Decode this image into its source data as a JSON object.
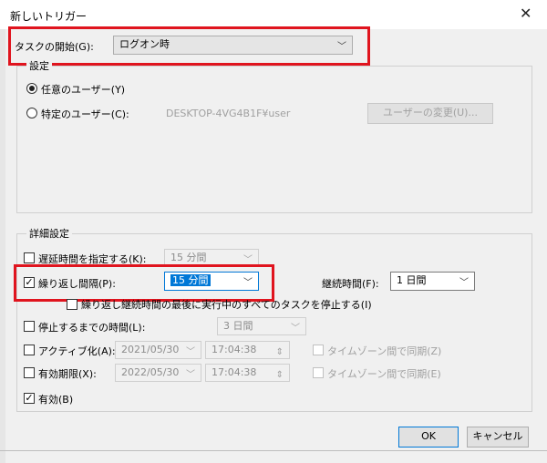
{
  "dialog": {
    "title": "新しいトリガー",
    "close_glyph": "✕"
  },
  "task_start": {
    "label": "タスクの開始(G):",
    "value": "ログオン時"
  },
  "settings": {
    "legend": "設定",
    "any_user": "任意のユーザー(Y)",
    "specific_user": "特定のユーザー(C):",
    "user_name": "DESKTOP-4VG4B1F¥user",
    "change_user_button": "ユーザーの変更(U)..."
  },
  "advanced": {
    "legend": "詳細設定",
    "delay_label": "遅延時間を指定する(K):",
    "delay_value": "15 分間",
    "repeat_label": "繰り返し間隔(P):",
    "repeat_value": "15 分間",
    "duration_label": "継続時間(F):",
    "duration_value": "1 日間",
    "stop_all_label": "繰り返し継続時間の最後に実行中のすべてのタスクを停止する(I)",
    "stop_after_label": "停止するまでの時間(L):",
    "stop_after_value": "3 日間",
    "activate_label": "アクティブ化(A):",
    "activate_date": "2021/05/30",
    "activate_time": "17:04:38",
    "expire_label": "有効期限(X):",
    "expire_date": "2022/05/30",
    "expire_time": "17:04:38",
    "sync_tz_label_1": "タイムゾーン間で同期(Z)",
    "sync_tz_label_2": "タイムゾーン間で同期(E)",
    "enabled_label": "有効(B)",
    "checked_glyph": "✓"
  },
  "buttons": {
    "ok": "OK",
    "cancel": "キャンセル"
  },
  "icons": {
    "dropdown": "chevron-down-icon",
    "spinner": "spinner-icon"
  },
  "colors": {
    "highlight": "#e0141e",
    "selection": "#0078d7"
  }
}
